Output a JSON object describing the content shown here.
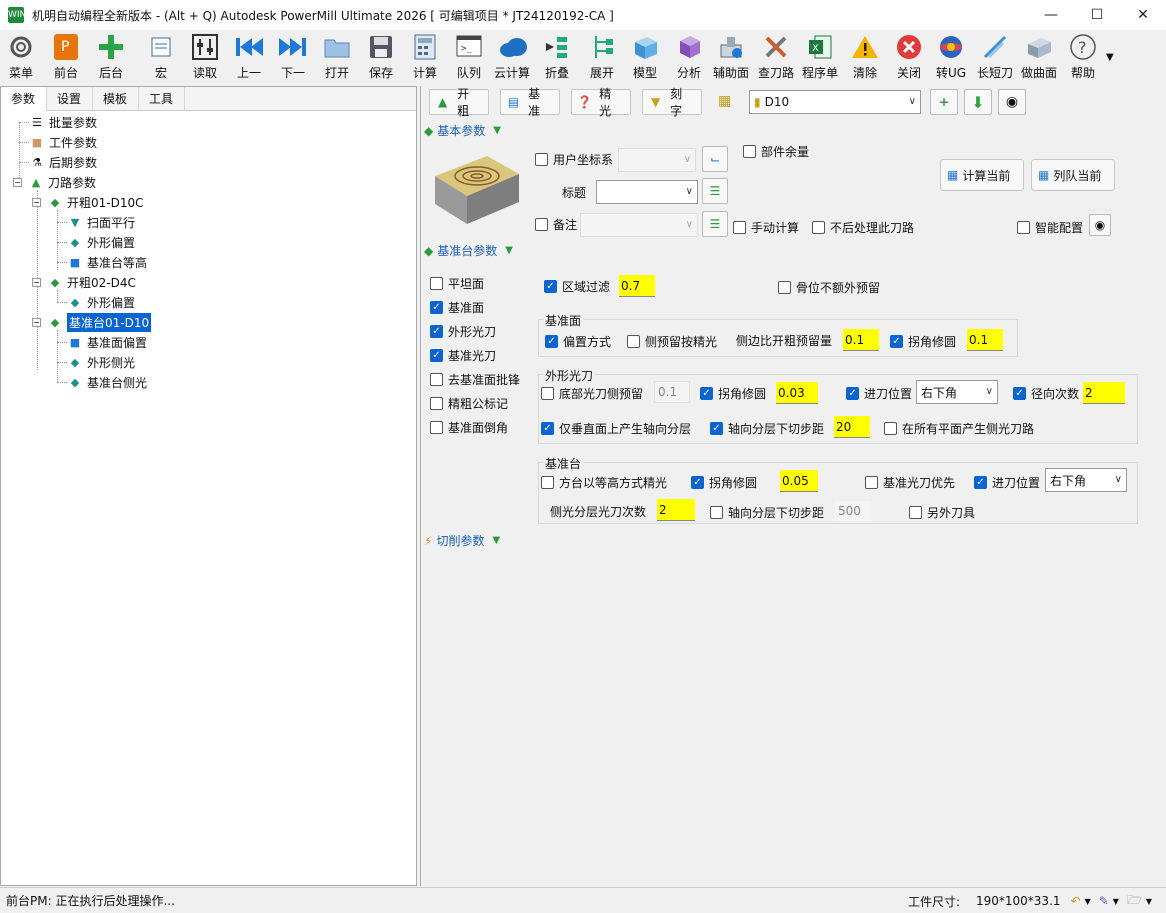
{
  "window": {
    "app_icon_text": "WIN",
    "title": "机明自动编程全新版本 - (Alt + Q) Autodesk PowerMill Ultimate 2026    [ 可编辑项目 * JT24120192-CA ]"
  },
  "toolbar": {
    "items": [
      {
        "label": "菜单",
        "icon": "gear-icon"
      },
      {
        "label": "前台",
        "icon": "powermill-icon"
      },
      {
        "label": "后台",
        "icon": "plus-icon"
      },
      {
        "label": "宏",
        "icon": "macro-icon"
      },
      {
        "label": "读取",
        "icon": "sliders-icon"
      },
      {
        "label": "上一",
        "icon": "previous-icon"
      },
      {
        "label": "下一",
        "icon": "next-icon"
      },
      {
        "label": "打开",
        "icon": "folder-icon"
      },
      {
        "label": "保存",
        "icon": "save-icon"
      },
      {
        "label": "计算",
        "icon": "calculator-icon"
      },
      {
        "label": "队列",
        "icon": "terminal-icon"
      },
      {
        "label": "云计算",
        "icon": "cloud-icon"
      },
      {
        "label": "折叠",
        "icon": "collapse-icon"
      },
      {
        "label": "展开",
        "icon": "expand-icon"
      },
      {
        "label": "模型",
        "icon": "cube-icon"
      },
      {
        "label": "分析",
        "icon": "analysis-icon"
      },
      {
        "label": "辅助面",
        "icon": "aux-surface-icon"
      },
      {
        "label": "查刀路",
        "icon": "tools-icon"
      },
      {
        "label": "程序单",
        "icon": "excel-icon"
      },
      {
        "label": "清除",
        "icon": "warning-icon"
      },
      {
        "label": "关闭",
        "icon": "close-circle-icon"
      },
      {
        "label": "转UG",
        "icon": "ug-icon"
      },
      {
        "label": "长短刀",
        "icon": "long-short-tool-icon"
      },
      {
        "label": "做曲面",
        "icon": "surface-icon"
      },
      {
        "label": "帮助",
        "icon": "help-icon"
      }
    ]
  },
  "left_tabs": [
    "参数",
    "设置",
    "模板",
    "工具"
  ],
  "tree": [
    {
      "label": "批量参数",
      "icon": "batch-icon"
    },
    {
      "label": "工件参数",
      "icon": "workpiece-icon"
    },
    {
      "label": "后期参数",
      "icon": "post-icon"
    },
    {
      "label": "刀路参数",
      "icon": "toolpath-icon"
    },
    {
      "label": "开粗01-D10C",
      "icon": "rough-icon"
    },
    {
      "label": "扫面平行",
      "icon": "raster-icon"
    },
    {
      "label": "外形偏置",
      "icon": "offset-icon"
    },
    {
      "label": "基准台等高",
      "icon": "constant-z-icon"
    },
    {
      "label": "开粗02-D4C",
      "icon": "rough-icon"
    },
    {
      "label": "外形偏置",
      "icon": "offset-icon"
    },
    {
      "label": "基准台01-D10",
      "icon": "datum-icon"
    },
    {
      "label": "基准面偏置",
      "icon": "datum-offset-icon"
    },
    {
      "label": "外形侧光",
      "icon": "side-finish-icon"
    },
    {
      "label": "基准台侧光",
      "icon": "side-finish-icon"
    }
  ],
  "top_buttons": [
    "开粗",
    "基准",
    "精光",
    "刻字"
  ],
  "tool_select": "D10",
  "basic": {
    "header": "基本参数",
    "user_cs": "用户坐标系",
    "part_allowance": "部件余量",
    "title_label": "标题",
    "note": "备注",
    "manual_calc": "手动计算",
    "no_post": "不后处理此刀路",
    "smart_config": "智能配置",
    "calc_current": "计算当前",
    "queue_current": "列队当前"
  },
  "datum": {
    "header": "基准台参数",
    "left_options": [
      {
        "label": "平坦面",
        "checked": false
      },
      {
        "label": "基准面",
        "checked": true
      },
      {
        "label": "外形光刀",
        "checked": true
      },
      {
        "label": "基准光刀",
        "checked": true
      },
      {
        "label": "去基准面批锋",
        "checked": false
      },
      {
        "label": "精粗公标记",
        "checked": false
      },
      {
        "label": "基准面倒角",
        "checked": false
      }
    ],
    "region_filter": "区域过滤",
    "region_filter_value": "0.7",
    "bone_no_extra": "骨位不额外预留",
    "datum_face": {
      "title": "基准面",
      "offset_mode": "偏置方式",
      "side_as_finish": "侧预留按精光",
      "side_vs_rough": "侧边比开粗预留量",
      "side_vs_rough_value": "0.1",
      "corner_fix": "拐角修圆",
      "corner_fix_value": "0.1"
    },
    "outer_finish": {
      "title": "外形光刀",
      "bottom_side": "底部光刀侧预留",
      "bottom_side_value": "0.1",
      "corner_fix": "拐角修圆",
      "corner_fix_value": "0.03",
      "entry_pos": "进刀位置",
      "entry_pos_value": "右下角",
      "radial_count": "径向次数",
      "radial_count_value": "2",
      "only_vertical": "仅垂直面上产生轴向分层",
      "axial_step": "轴向分层下切步距",
      "axial_step_value": "20",
      "all_flat": "在所有平面产生侧光刀路"
    },
    "datum_table": {
      "title": "基准台",
      "square_constz": "方台以等高方式精光",
      "corner_fix": "拐角修圆",
      "corner_fix_value": "0.05",
      "datum_first": "基准光刀优先",
      "entry_pos": "进刀位置",
      "entry_pos_value": "右下角",
      "side_passes": "侧光分层光刀次数",
      "side_passes_value": "2",
      "axial_step": "轴向分层下切步距",
      "axial_step_value": "500",
      "extra_tool": "另外刀具"
    }
  },
  "cut": {
    "header": "切削参数"
  },
  "status": {
    "left": "前台PM: 正在执行后处理操作...",
    "size_label": "工件尺寸:",
    "size_value": "190*100*33.1"
  },
  "colors": {
    "accent": "#0a64d2",
    "highlight": "#ffff00",
    "section": "#1a5fb4"
  }
}
